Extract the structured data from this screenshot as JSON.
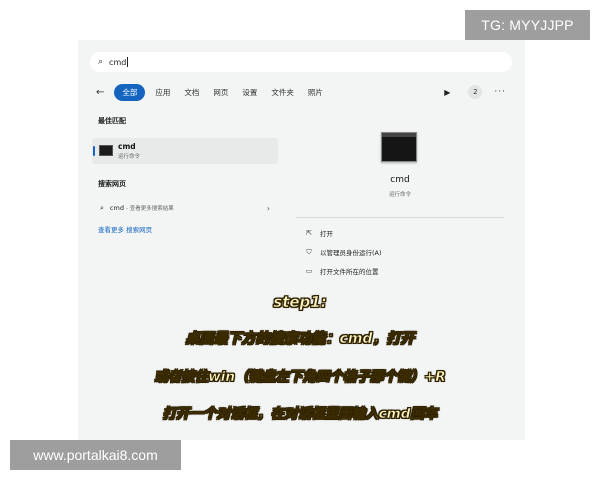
{
  "watermarks": {
    "top": "TG: MYYJJPP",
    "bottom": "www.portalkai8.com"
  },
  "search": {
    "icon": "search-icon",
    "value": "cmd"
  },
  "filters": {
    "back_icon": "arrow-left-icon",
    "tabs": [
      "全部",
      "应用",
      "文档",
      "网页",
      "设置",
      "文件夹",
      "照片"
    ],
    "play_icon": "play-icon",
    "badge": "2",
    "more_icon": "ellipsis-icon"
  },
  "best_match": {
    "title": "最佳匹配",
    "name": "cmd",
    "sub": "运行命令",
    "icon": "terminal-icon"
  },
  "web": {
    "title": "搜索网页",
    "query": "cmd",
    "hint": "- 查看更多搜索结果",
    "more": "查看更多 搜索网页"
  },
  "detail": {
    "icon": "terminal-icon",
    "name": "cmd",
    "sub": "运行命令",
    "actions": [
      {
        "icon": "open-icon",
        "label": "打开"
      },
      {
        "icon": "shield-icon",
        "label": "以管理员身份运行(A)"
      },
      {
        "icon": "folder-icon",
        "label": "打开文件所在的位置"
      }
    ]
  },
  "overlay": [
    "step1:",
    "桌面最下方的搜索功能：cmd，打开",
    "或者按住win（键盘左下角四个格子那个键）+R",
    "打开一个对话框，在对话框里面输入cmd回车"
  ]
}
